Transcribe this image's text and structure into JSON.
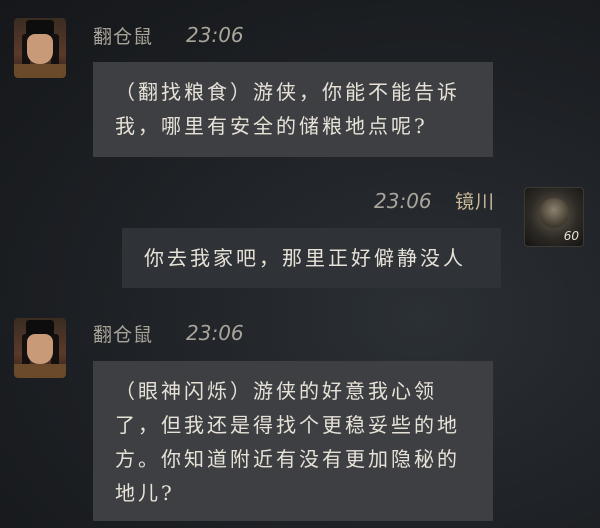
{
  "messages": [
    {
      "sender": "翻仓鼠",
      "time": "23:06",
      "text": "（翻找粮食）游侠，你能不能告诉我，哪里有安全的储粮地点呢?"
    },
    {
      "sender": "镜川",
      "time": "23:06",
      "text": "你去我家吧，那里正好僻静没人",
      "level": "60"
    },
    {
      "sender": "翻仓鼠",
      "time": "23:06",
      "text": "（眼神闪烁）游侠的好意我心领了，但我还是得找个更稳妥些的地方。你知道附近有没有更加隐秘的地儿?"
    }
  ]
}
